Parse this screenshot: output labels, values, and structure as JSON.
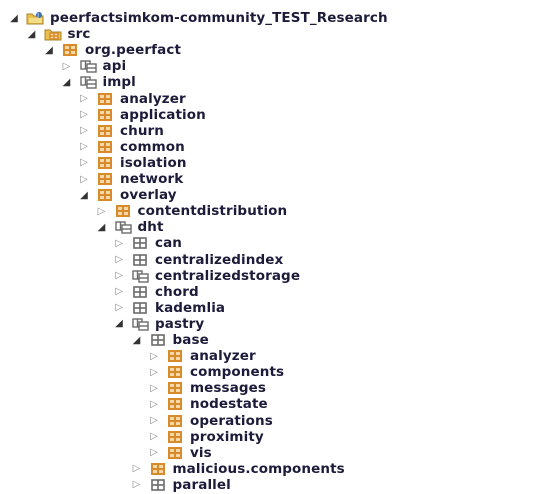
{
  "tree": [
    {
      "label": "peerfactsimkom-community_TEST_Research",
      "icon": "project-icon",
      "expanded": true,
      "depth": 0,
      "hasToggle": true
    },
    {
      "label": "src",
      "icon": "source-folder-icon",
      "expanded": true,
      "depth": 1,
      "hasToggle": true
    },
    {
      "label": "org.peerfact",
      "icon": "package-icon",
      "expanded": true,
      "depth": 2,
      "hasToggle": true
    },
    {
      "label": "api",
      "icon": "empty-package-icon",
      "expanded": false,
      "depth": 3,
      "hasToggle": true
    },
    {
      "label": "impl",
      "icon": "empty-package-icon",
      "expanded": true,
      "depth": 3,
      "hasToggle": true
    },
    {
      "label": "analyzer",
      "icon": "package-icon",
      "expanded": false,
      "depth": 4,
      "hasToggle": true
    },
    {
      "label": "application",
      "icon": "package-icon",
      "expanded": false,
      "depth": 4,
      "hasToggle": true
    },
    {
      "label": "churn",
      "icon": "package-icon",
      "expanded": false,
      "depth": 4,
      "hasToggle": true
    },
    {
      "label": "common",
      "icon": "package-icon",
      "expanded": false,
      "depth": 4,
      "hasToggle": true
    },
    {
      "label": "isolation",
      "icon": "package-icon",
      "expanded": false,
      "depth": 4,
      "hasToggle": true
    },
    {
      "label": "network",
      "icon": "package-icon",
      "expanded": false,
      "depth": 4,
      "hasToggle": true
    },
    {
      "label": "overlay",
      "icon": "package-icon",
      "expanded": true,
      "depth": 4,
      "hasToggle": true
    },
    {
      "label": "contentdistribution",
      "icon": "package-icon",
      "expanded": false,
      "depth": 5,
      "hasToggle": true
    },
    {
      "label": "dht",
      "icon": "empty-package-icon",
      "expanded": true,
      "depth": 5,
      "hasToggle": true
    },
    {
      "label": "can",
      "icon": "gray-package-icon",
      "expanded": false,
      "depth": 6,
      "hasToggle": true
    },
    {
      "label": "centralizedindex",
      "icon": "gray-package-icon",
      "expanded": false,
      "depth": 6,
      "hasToggle": true
    },
    {
      "label": "centralizedstorage",
      "icon": "empty-package-icon",
      "expanded": false,
      "depth": 6,
      "hasToggle": true
    },
    {
      "label": "chord",
      "icon": "gray-package-icon",
      "expanded": false,
      "depth": 6,
      "hasToggle": true
    },
    {
      "label": "kademlia",
      "icon": "gray-package-icon",
      "expanded": false,
      "depth": 6,
      "hasToggle": true
    },
    {
      "label": "pastry",
      "icon": "empty-package-icon",
      "expanded": true,
      "depth": 6,
      "hasToggle": true
    },
    {
      "label": "base",
      "icon": "gray-package-icon",
      "expanded": true,
      "depth": 7,
      "hasToggle": true
    },
    {
      "label": "analyzer",
      "icon": "package-icon",
      "expanded": false,
      "depth": 8,
      "hasToggle": true
    },
    {
      "label": "components",
      "icon": "package-icon",
      "expanded": false,
      "depth": 8,
      "hasToggle": true
    },
    {
      "label": "messages",
      "icon": "package-icon",
      "expanded": false,
      "depth": 8,
      "hasToggle": true
    },
    {
      "label": "nodestate",
      "icon": "package-icon",
      "expanded": false,
      "depth": 8,
      "hasToggle": true
    },
    {
      "label": "operations",
      "icon": "package-icon",
      "expanded": false,
      "depth": 8,
      "hasToggle": true
    },
    {
      "label": "proximity",
      "icon": "package-icon",
      "expanded": false,
      "depth": 8,
      "hasToggle": true
    },
    {
      "label": "vis",
      "icon": "package-icon",
      "expanded": false,
      "depth": 8,
      "hasToggle": true
    },
    {
      "label": "malicious.components",
      "icon": "package-icon",
      "expanded": false,
      "depth": 7,
      "hasToggle": true
    },
    {
      "label": "parallel",
      "icon": "gray-package-icon",
      "expanded": false,
      "depth": 7,
      "hasToggle": true
    }
  ],
  "colors": {
    "package_orange": "#d98a2b",
    "package_gray": "#6b6b6b",
    "project_folder": "#e8c04a",
    "project_blue": "#3c6fb3",
    "text": "#1c1c3a"
  }
}
